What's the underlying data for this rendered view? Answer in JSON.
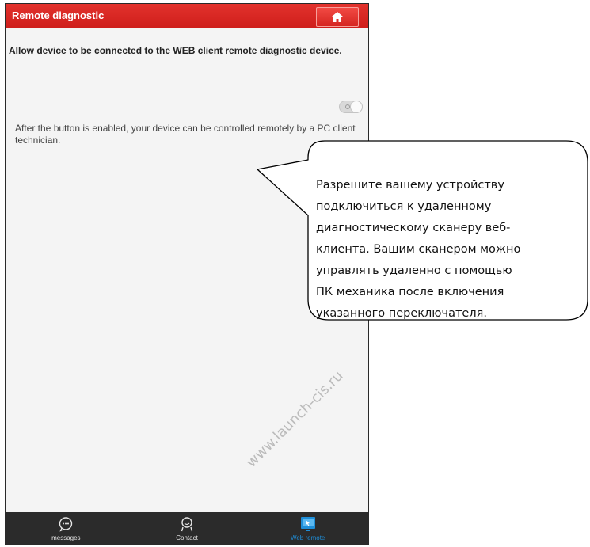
{
  "app": {
    "title": "Remote diagnostic",
    "home_icon": "home-icon"
  },
  "main": {
    "description": "Allow device to be connected to the WEB client remote diagnostic device.",
    "toggle": {
      "enabled": false
    },
    "hint": "After the button is enabled, your device can be controlled remotely by a PC client technician."
  },
  "watermark": "www.launch-cis.ru",
  "callout": {
    "lines": [
      "Разрешите вашему устройству",
      "подключиться к удаленному",
      "диагностическому сканеру веб-",
      "клиента.  Вашим сканером можно",
      "управлять удаленно с помощью",
      "ПК механика после включения",
      "указанного переключателя."
    ]
  },
  "tabbar": {
    "tabs": [
      {
        "label": "messages",
        "icon": "chat-bubble-icon",
        "active": false
      },
      {
        "label": "Contact",
        "icon": "contact-icon",
        "active": false
      },
      {
        "label": "Web remote",
        "icon": "monitor-icon",
        "active": true
      }
    ]
  },
  "colors": {
    "titlebar": "#d32521",
    "tabbar": "#2b2b2b",
    "active_tab": "#1e8ed8"
  }
}
